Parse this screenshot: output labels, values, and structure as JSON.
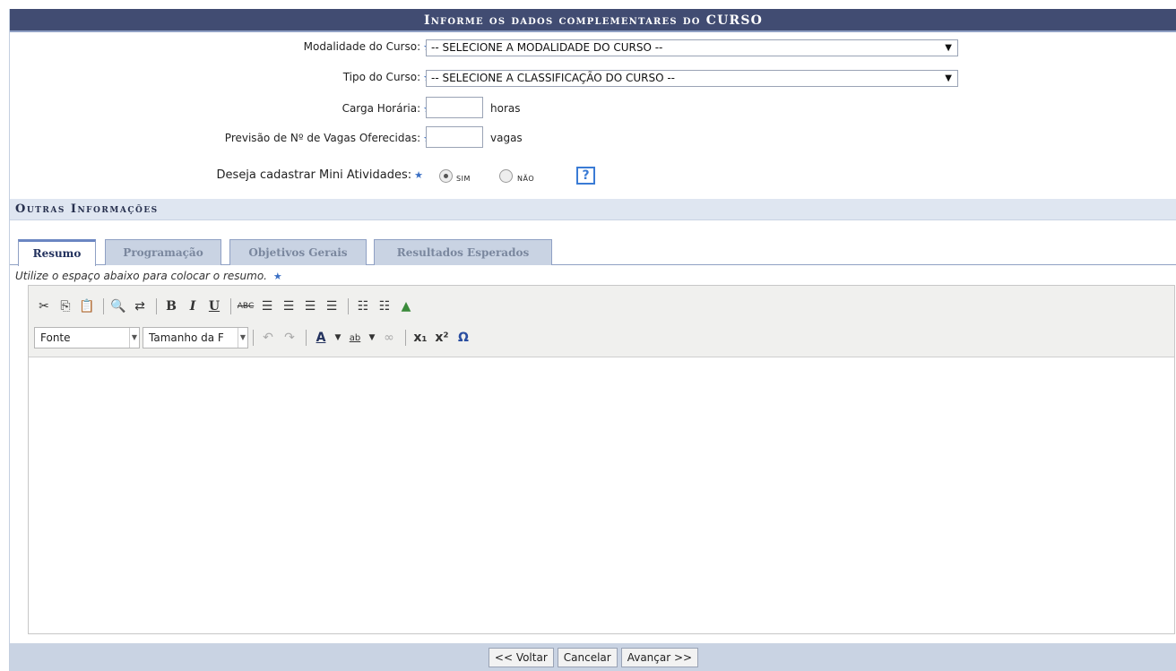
{
  "header": {
    "title": "Informe os dados complementares do CURSO"
  },
  "form": {
    "modalidade": {
      "label": "Modalidade do Curso:",
      "value": "-- SELECIONE A MODALIDADE DO CURSO --"
    },
    "tipo": {
      "label": "Tipo do Curso:",
      "value": "-- SELECIONE A CLASSIFICAÇÃO DO CURSO --"
    },
    "carga": {
      "label": "Carga Horária:",
      "unit": "horas"
    },
    "vagas": {
      "label": "Previsão de Nº de Vagas Oferecidas:",
      "unit": "vagas"
    },
    "mini": {
      "label": "Deseja cadastrar Mini Atividades:",
      "opt_yes": "sim",
      "opt_no": "não",
      "selected": "sim"
    },
    "required_mark": "★",
    "help_glyph": "?"
  },
  "section": {
    "title": "Outras Informações"
  },
  "tabs": [
    {
      "label": "Resumo",
      "active": true
    },
    {
      "label": "Programação",
      "active": false
    },
    {
      "label": "Objetivos Gerais",
      "active": false
    },
    {
      "label": "Resultados Esperados",
      "active": false
    }
  ],
  "editor": {
    "note": "Utilize o espaço abaixo para colocar o resumo.",
    "font_combo": "Fonte",
    "size_combo": "Tamanho da F"
  },
  "footer": {
    "back": "<< Voltar",
    "cancel": "Cancelar",
    "next": "Avançar >>"
  }
}
